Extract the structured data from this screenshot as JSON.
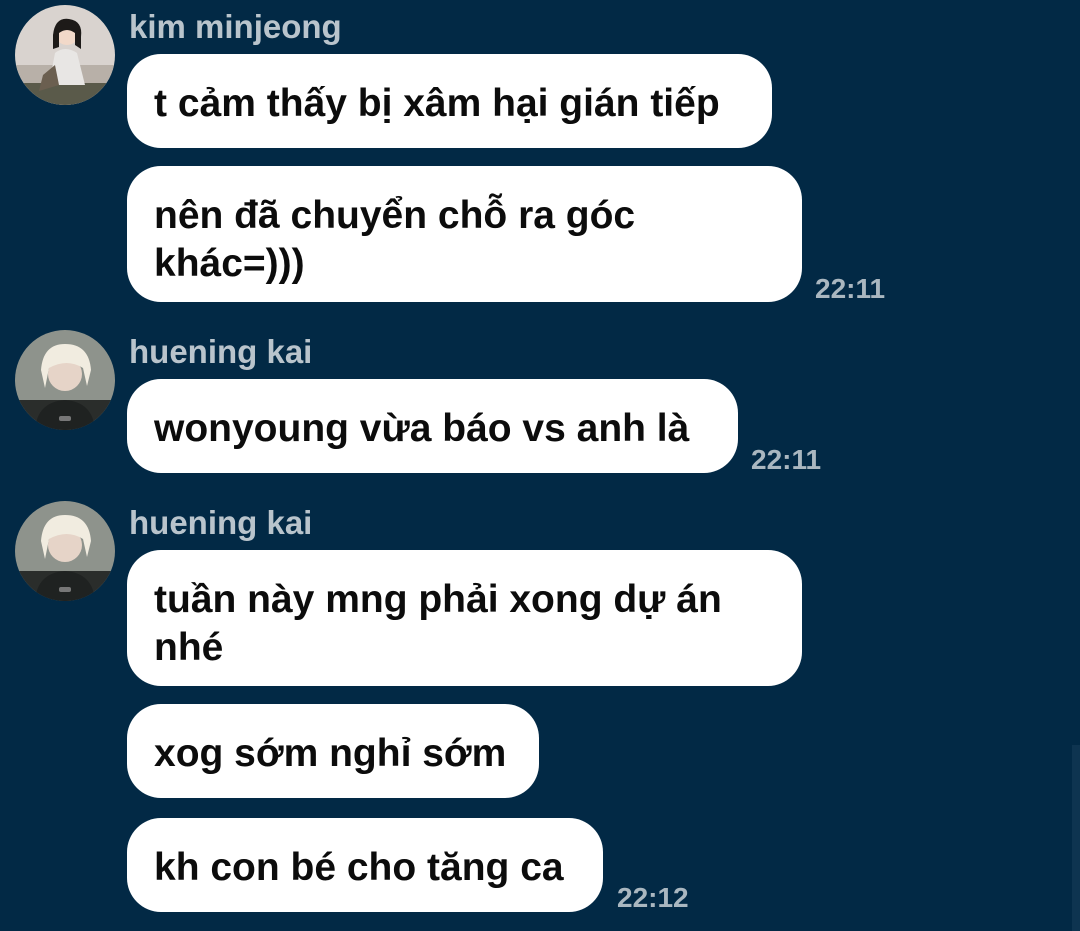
{
  "messages": [
    {
      "sender": "kim minjeong",
      "avatar_icon": "avatar-kim-minjeong",
      "bubbles": [
        "t cảm thấy bị xâm hại gián tiếp",
        "nên đã chuyển chỗ ra góc khác=)))"
      ],
      "time": "22:11"
    },
    {
      "sender": "huening kai",
      "avatar_icon": "avatar-huening-kai",
      "bubbles": [
        "wonyoung vừa báo vs anh là"
      ],
      "time": "22:11"
    },
    {
      "sender": "huening kai",
      "avatar_icon": "avatar-huening-kai",
      "bubbles": [
        "tuần này mng phải xong dự án nhé",
        "xog sớm nghỉ sớm",
        "kh con bé cho tăng ca"
      ],
      "time": "22:12"
    }
  ],
  "colors": {
    "background": "#022945",
    "bubble": "#ffffff",
    "sender_name": "#b9c4cc",
    "timestamp": "#aab7c0"
  }
}
